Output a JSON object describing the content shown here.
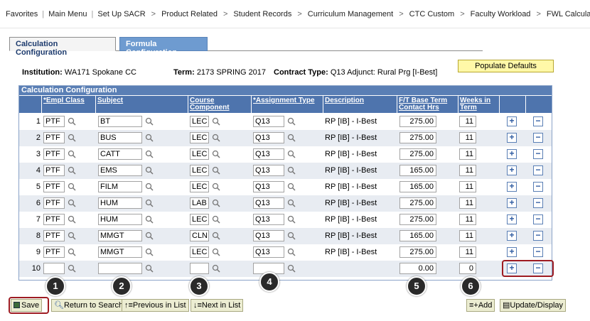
{
  "nav": {
    "items": [
      "Favorites",
      "Main Menu",
      "Set Up SACR",
      "Product Related",
      "Student Records",
      "Curriculum Management",
      "CTC Custom",
      "Faculty Workload",
      "FWL Calcula"
    ]
  },
  "tabs": {
    "active": "Calculation Configuration",
    "inactive": "Formula Configuration"
  },
  "header": {
    "institution_label": "Institution:",
    "institution_value": "WA171  Spokane CC",
    "term_label": "Term:",
    "term_value": "2173  SPRING 2017",
    "contract_label": "Contract Type:",
    "contract_value": "Q13  Adjunct: Rural Prg [I-Best]",
    "populate_button": "Populate Defaults"
  },
  "grid": {
    "title": "Calculation Configuration",
    "columns": {
      "empl_class": "*Empl Class",
      "subject": "Subject",
      "course_component_1": "Course",
      "course_component_2": "Component",
      "assignment_type": "*Assignment Type",
      "description": "Description",
      "base_term_1": "F/T Base Term",
      "base_term_2": "Contact Hrs",
      "weeks_1": "Weeks in",
      "weeks_2": "Term"
    },
    "rows": [
      {
        "num": "1",
        "empl": "PTF",
        "subject": "BT",
        "comp": "LEC",
        "assign": "Q13",
        "desc": "RP [IB] - I-Best",
        "hrs": "275.00",
        "weeks": "11"
      },
      {
        "num": "2",
        "empl": "PTF",
        "subject": "BUS",
        "comp": "LEC",
        "assign": "Q13",
        "desc": "RP [IB] - I-Best",
        "hrs": "275.00",
        "weeks": "11"
      },
      {
        "num": "3",
        "empl": "PTF",
        "subject": "CATT",
        "comp": "LEC",
        "assign": "Q13",
        "desc": "RP [IB] - I-Best",
        "hrs": "275.00",
        "weeks": "11"
      },
      {
        "num": "4",
        "empl": "PTF",
        "subject": "EMS",
        "comp": "LEC",
        "assign": "Q13",
        "desc": "RP [IB] - I-Best",
        "hrs": "165.00",
        "weeks": "11"
      },
      {
        "num": "5",
        "empl": "PTF",
        "subject": "FILM",
        "comp": "LEC",
        "assign": "Q13",
        "desc": "RP [IB] - I-Best",
        "hrs": "165.00",
        "weeks": "11"
      },
      {
        "num": "6",
        "empl": "PTF",
        "subject": "HUM",
        "comp": "LAB",
        "assign": "Q13",
        "desc": "RP [IB] - I-Best",
        "hrs": "275.00",
        "weeks": "11"
      },
      {
        "num": "7",
        "empl": "PTF",
        "subject": "HUM",
        "comp": "LEC",
        "assign": "Q13",
        "desc": "RP [IB] - I-Best",
        "hrs": "275.00",
        "weeks": "11"
      },
      {
        "num": "8",
        "empl": "PTF",
        "subject": "MMGT",
        "comp": "CLN",
        "assign": "Q13",
        "desc": "RP [IB] - I-Best",
        "hrs": "165.00",
        "weeks": "11"
      },
      {
        "num": "9",
        "empl": "PTF",
        "subject": "MMGT",
        "comp": "LEC",
        "assign": "Q13",
        "desc": "RP [IB] - I-Best",
        "hrs": "275.00",
        "weeks": "11"
      },
      {
        "num": "10",
        "empl": "",
        "subject": "",
        "comp": "",
        "assign": "",
        "desc": "",
        "hrs": "0.00",
        "weeks": "0"
      }
    ]
  },
  "buttons": {
    "save": "Save",
    "return_search": "Return to Search",
    "previous": "Previous in List",
    "next": "Next in List",
    "add": "Add",
    "update": "Update/Display"
  },
  "callouts": [
    "1",
    "2",
    "3",
    "4",
    "5",
    "6"
  ],
  "colors": {
    "grid_header": "#4e74ad",
    "highlight": "#9e1c22",
    "populate_bg": "#fff8a8"
  }
}
